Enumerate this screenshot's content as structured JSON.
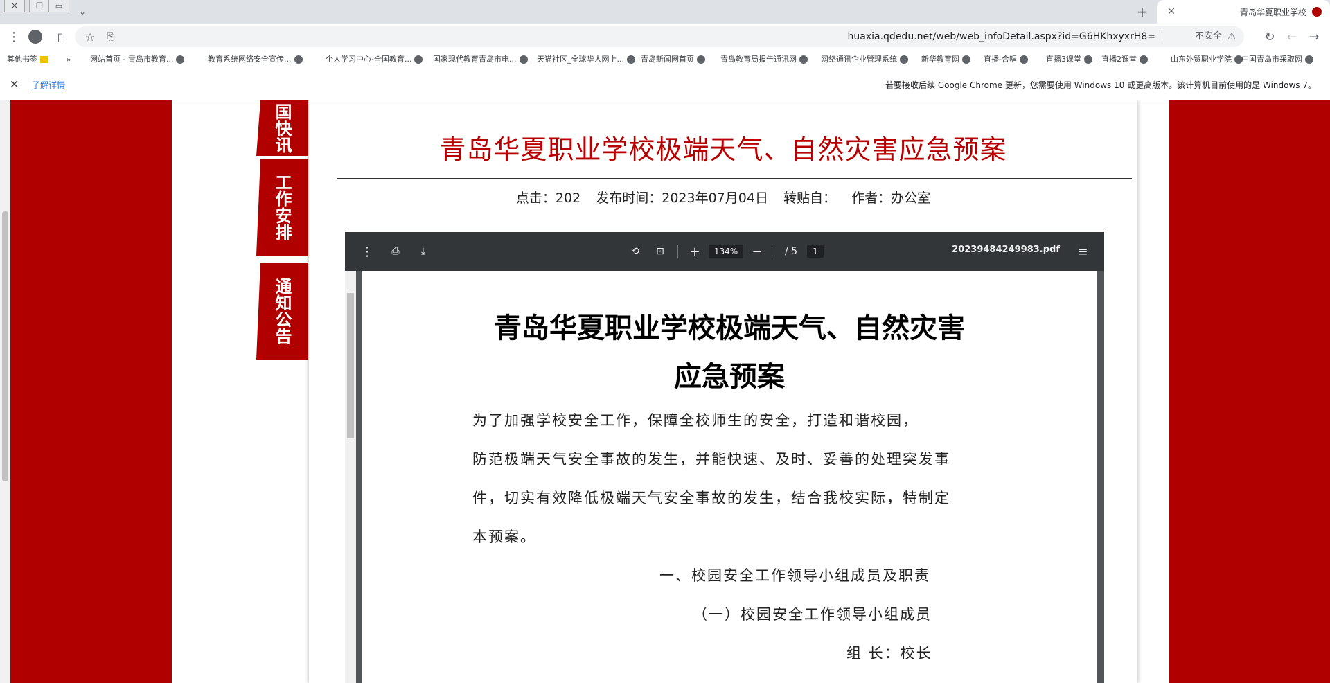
{
  "browser": {
    "tab_title": "青岛华夏职业学校",
    "url": "huaxia.qdedu.net/web/web_infoDetail.aspx?id=G6HKhxyxrH8=",
    "security_label": "不安全",
    "bookmarks": [
      "中国青岛市采取网",
      "山东外贸职业学院",
      "直播2课堂",
      "直播3课堂",
      "直播-合唱",
      "新华教育网",
      "网络通讯企业管理系统",
      "青岛教育局报告通讯网",
      "青岛新闻网首页",
      "天猫社区_全球华人网上...",
      "国家现代教育青岛市电...",
      "个人学习中心-全国教育...",
      "教育系统网络安全宣传...",
      "网站首页 - 青岛市教育...",
      "其他书签"
    ],
    "info_text": "若要接收后续 Google Chrome 更新，您需要使用 Windows 10 或更高版本。该计算机目前使用的是 Windows 7。",
    "info_link": "了解详情"
  },
  "sidebar": {
    "tabs": [
      {
        "label": "国快讯"
      },
      {
        "label": "工作安排"
      },
      {
        "label": "通知公告"
      }
    ]
  },
  "article": {
    "title": "青岛华夏职业学校极端天气、自然灾害应急预案",
    "author": "作者：办公室",
    "source": "转贴自：",
    "date": "发布时间：2023年07月04日",
    "hits": "点击：202"
  },
  "pdf": {
    "filename": "20239484249983.pdf",
    "page_current": "1",
    "page_total": "/ 5",
    "zoom": "134%",
    "title_line1": "青岛华夏职业学校极端天气、自然灾害",
    "title_line2": "应急预案",
    "lines": [
      "为了加强学校安全工作，保障全校师生的安全，打造和谐校园，",
      "防范极端天气安全事故的发生，并能快速、及时、妥善的处理突发事",
      "件，切实有效降低极端天气安全事故的发生，结合我校实际，特制定",
      "本预案。",
      "一、校园安全工作领导小组成员及职责",
      "（一）校园安全工作领导小组成员",
      "组   长：校长"
    ]
  },
  "colors": {
    "brand_red": "#b00000",
    "title_red": "#b80000",
    "pdf_toolbar": "#323639"
  }
}
